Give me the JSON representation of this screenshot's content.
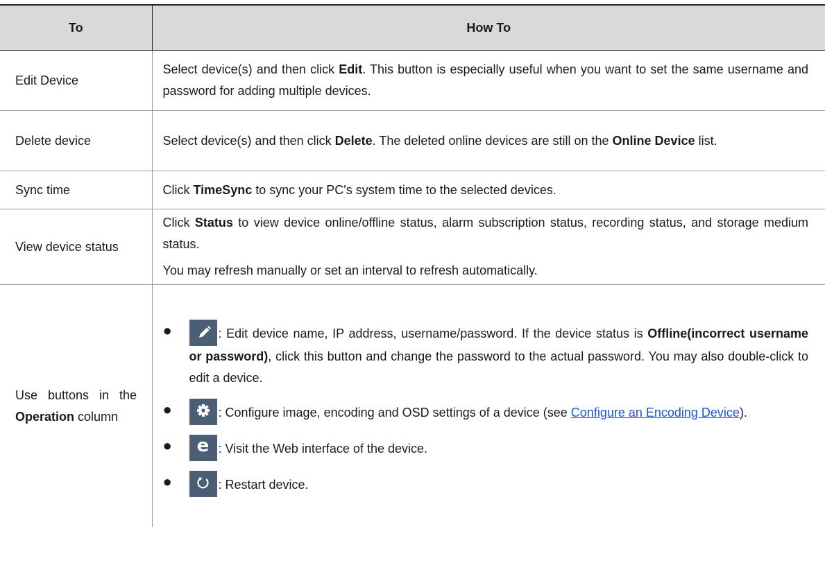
{
  "table": {
    "headers": {
      "col1": "To",
      "col2": "How To"
    },
    "rows": [
      {
        "to": "Edit Device",
        "how_parts": [
          "Select device(s) and then click ",
          "Edit",
          ". This button is especially useful when you want to set the same username and password for adding multiple devices."
        ]
      },
      {
        "to": "Delete device",
        "how_parts": [
          "Select device(s) and then click ",
          "Delete",
          ". The deleted online devices are still on the ",
          "Online Device",
          " list."
        ]
      },
      {
        "to": "Sync time",
        "how_parts": [
          "Click ",
          "TimeSync",
          " to sync your PC's system time to the selected devices."
        ]
      },
      {
        "to": "View device status",
        "how_parts": [
          "Click ",
          "Status",
          " to view device online/offline status, alarm subscription status, recording status, and storage medium status."
        ],
        "how_extra": "You may refresh manually or set an interval to refresh automatically."
      },
      {
        "to_parts": [
          "Use buttons in the ",
          "Operation",
          " column"
        ],
        "operations": [
          {
            "icon": "pencil-edit-icon",
            "text_parts": [
              ": Edit device name, IP address, username/password. If the device status is ",
              "Offline(incorrect username or password)",
              ", click this button and change the password to the actual password. You may also double-click to edit a device."
            ]
          },
          {
            "icon": "gear-icon",
            "text_parts": [
              ": Configure image, encoding and OSD settings of a device (see ",
              "Configure an Encoding Device",
              ")."
            ]
          },
          {
            "icon": "web-e-icon",
            "icon_glyph": "e",
            "text_parts": [
              ": Visit the Web interface of the device."
            ]
          },
          {
            "icon": "restart-icon",
            "text_parts": [
              ": Restart device."
            ]
          }
        ]
      }
    ]
  },
  "colors": {
    "header_bg": "#d9d9d9",
    "icon_bg": "#4c5e73",
    "link": "#1a56d6"
  },
  "bullet_glyph": "●"
}
